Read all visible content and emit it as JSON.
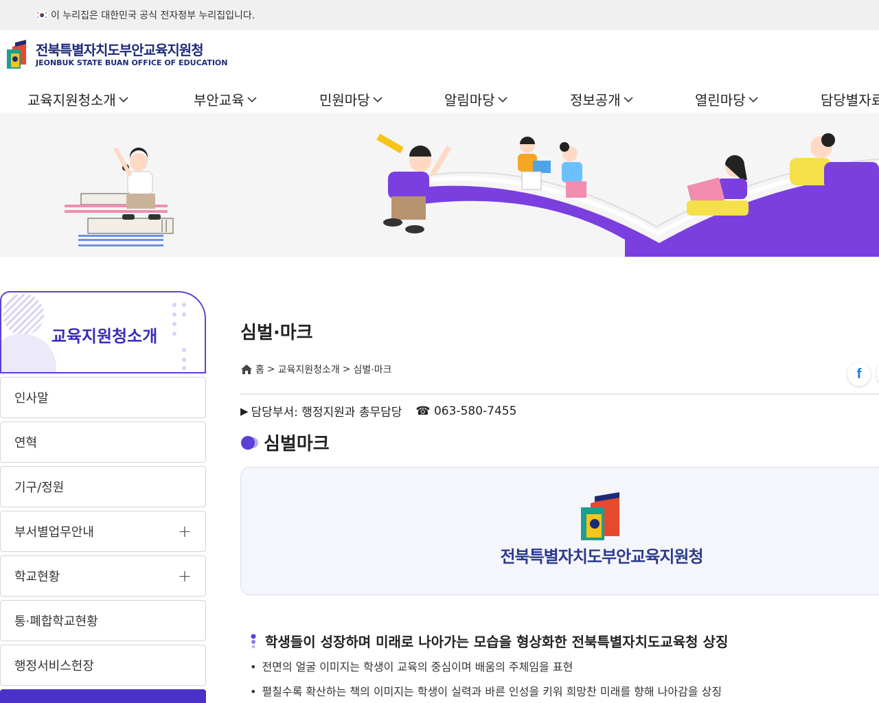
{
  "gov_banner": {
    "text": "이 누리집은 대한민국 공식 전자정부 누리집입니다."
  },
  "logo": {
    "name_ko": "전북특별자치도부안교육지원청",
    "name_en": "JEONBUK STATE BUAN OFFICE OF EDUCATION"
  },
  "gnb": {
    "items": [
      {
        "label": "교육지원청소개"
      },
      {
        "label": "부안교육"
      },
      {
        "label": "민원마당"
      },
      {
        "label": "알림마당"
      },
      {
        "label": "정보공개"
      },
      {
        "label": "열린마당"
      },
      {
        "label": "담당별자료"
      }
    ]
  },
  "lnb": {
    "title": "교육지원청소개",
    "items": [
      {
        "label": "인사말",
        "expandable": false
      },
      {
        "label": "연혁",
        "expandable": false
      },
      {
        "label": "기구/정원",
        "expandable": false
      },
      {
        "label": "부서별업무안내",
        "expandable": true,
        "icon": "+"
      },
      {
        "label": "학교현황",
        "expandable": true,
        "icon": "+"
      },
      {
        "label": "통·폐합학교현황",
        "expandable": false
      },
      {
        "label": "행정서비스헌장",
        "expandable": false
      }
    ]
  },
  "content": {
    "page_title": "심벌·마크",
    "breadcrumb": {
      "home": "홈",
      "sep": ">",
      "level1": "교육지원청소개",
      "level2": "심벌·마크"
    },
    "share": {
      "facebook_label": "f"
    },
    "dept": {
      "marker": "▶",
      "label": "담당부서: 행정지원과 총무담당",
      "phone": "☎ 063-580-7455"
    },
    "section_title": "심벌마크",
    "symbol_name": "전북특별자치도부안교육지원청",
    "desc_title": "학생들이 성장하며 미래로 나아가는 모습을 형상화한 전북특별자치도교육청 상징",
    "desc_items": [
      "전면의 얼굴 이미지는 학생이 교육의 중심이며 배움의 주체임을 표현",
      "펼칠수록 확산하는 책의 이미지는 학생이 실력과 바른 인성을 키워 희망찬 미래를 향해 나아감을 상징"
    ],
    "desc_bullet": "•"
  },
  "colors": {
    "brand_navy": "#1d2a78",
    "accent_purple": "#5b3fd6",
    "lnb_active": "#4a32c8"
  },
  "icons": [
    "korea-flag-icon",
    "chevron-down-icon",
    "home-icon",
    "facebook-icon",
    "plus-icon",
    "phone-icon"
  ]
}
